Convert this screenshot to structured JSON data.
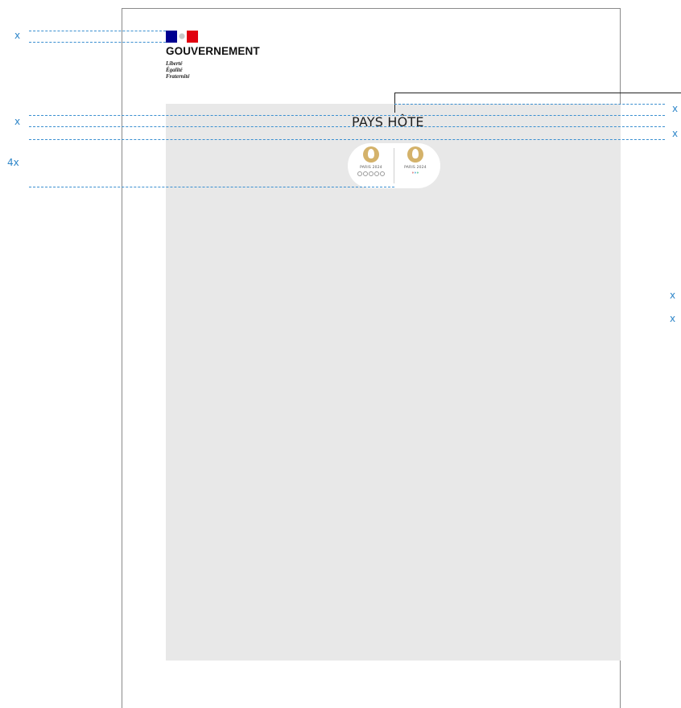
{
  "government_logo": {
    "name": "GOUVERNEMENT",
    "motto": [
      "Liberté",
      "Égalité",
      "Fraternité"
    ]
  },
  "host_country_label": "PAYS HÔTE",
  "partner_logos": {
    "olympic_wordmark": "PARIS 2024",
    "paralympic_wordmark": "PARIS 2024"
  },
  "measurement_marks": {
    "left_top": "x",
    "left_middle": "x",
    "left_bottom": "4x",
    "right_1": "x",
    "right_2": "x",
    "right_3": "x",
    "right_4": "x"
  },
  "colors": {
    "guide_line": "#3a8fd0",
    "mark_text": "#2e86c9",
    "clear_zone": "#e8e8e8",
    "flag_blue": "#000091",
    "flag_red": "#e1000f",
    "medal_gold": "#d4b26a"
  }
}
